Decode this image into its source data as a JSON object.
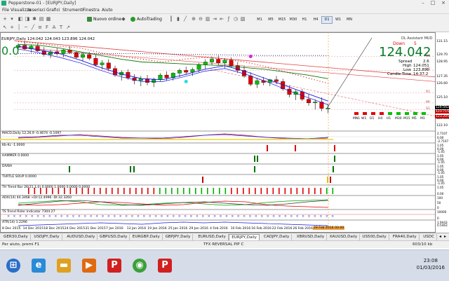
{
  "window": {
    "title": "Pepperstone-01 - [EURJPY,Daily]"
  },
  "menu": [
    "File",
    "Visualizza",
    "Inserisci",
    "Grafici",
    "Strumenti",
    "Finestra",
    "Aiuto"
  ],
  "toolbar": {
    "new_order": "Nuovo ordine",
    "autotrading": "AutoTrading",
    "timeframes": [
      "M1",
      "M5",
      "M15",
      "M30",
      "H1",
      "H4",
      "D1",
      "W1",
      "MN"
    ],
    "active_timeframe": "D1"
  },
  "chart": {
    "symbol_line": "EURJPY,Daily  124.042  124.043  123.896  124.042",
    "assistant_label": "DL Assistant MUD",
    "panel": {
      "direction": "Down",
      "direction_count": "5",
      "price": "124.042",
      "spread_label": "Spread",
      "spread_value": "2.6",
      "high_label": "High",
      "high_value": "124.051",
      "low_label": "Low",
      "low_value": "123.896",
      "candle_label": "Candle Time",
      "candle_value": "14:37:2",
      "mtf_labels": [
        "MN1",
        "W1",
        "D1",
        "H4",
        "H1",
        "M30",
        "M15",
        "M5",
        "M1"
      ],
      "mtf_colors": [
        "red",
        "red",
        "red",
        "red",
        "green",
        "green",
        "green",
        "green",
        "green"
      ]
    },
    "big_green_text": "0.0",
    "price_axis": [
      "131.15",
      "129.70",
      "128.95",
      "127.35",
      "126.60",
      "125.10",
      "124.042",
      "123.60",
      "122.855",
      "122.10"
    ],
    "price_tags": [
      {
        "text": "124.042",
        "color": "#000000"
      },
      {
        "text": "123.715",
        "color": "#c00000"
      },
      {
        "text": "123.205",
        "color": "#c00000"
      }
    ],
    "right_labels": [
      "R3",
      "R2",
      "R1",
      "PP",
      "S1"
    ],
    "indicators": [
      {
        "label": "MACD,Daily 12,26,9  -0.4674  -0.1097",
        "axis": [
          "2.7107",
          "0.00",
          "-2.7107"
        ]
      },
      {
        "label": "Kb-Kc -1.0000",
        "axis": [
          "1.05",
          "0.00",
          "-1.05"
        ]
      },
      {
        "label": "HAMMER 0.0000",
        "axis": [
          "1.05",
          "0.00",
          "-1.05"
        ]
      },
      {
        "label": "DIVBA",
        "axis": [
          "1.05",
          "0.00",
          "-1.05"
        ]
      },
      {
        "label": "TURTLE SOUP 0.0000",
        "axis": [
          "1.05",
          "0.00",
          "-1.05"
        ]
      },
      {
        "label": "TH Trend Bar 26(21,1,0) 0.0000 1.0000 0.0000 0.0000",
        "axis": [
          "1.05",
          "0.00"
        ]
      },
      {
        "label": "ADX(14) 44.3468 +DI:12.4996 -DI:32.3260",
        "axis": [
          "100",
          "50",
          "0"
        ]
      },
      {
        "label": "TS Trend Rider Indicator 7304.27",
        "axis": [
          "10000",
          "0"
        ]
      },
      {
        "label": "ATR(14) 1.2296",
        "axis": [
          "1.9443",
          "0.5463"
        ]
      }
    ],
    "dates": [
      "8 Dec 2015",
      "14 Dec 2015",
      "18 Dec 2015",
      "24 Dec 2015",
      "31 Dec 2015",
      "7 Jan 2016",
      "13 Jan 2016",
      "19 Jan 2016",
      "25 Jan 2016",
      "29 Jan 2016",
      "4 Feb 2016",
      "10 Feb 2016",
      "16 Feb 2016",
      "22 Feb 2016",
      "26 Feb 2016"
    ],
    "date_highlight": "29 Feb 2016 00:00"
  },
  "tabs": [
    "GER30,Daily",
    "USDJPY,Daily",
    "AUDUSD,Daily",
    "GBPUSD,Daily",
    "EURGBP,Daily",
    "GBPJPY,Daily",
    "EURUSD,Daily",
    "EURJPY,Daily",
    "CADJPY,Daily",
    "XBRUSD,Daily",
    "XAUUSD,Daily",
    "US500,Daily",
    "FRA40,Daily",
    "USDC"
  ],
  "active_tab": "EURJPY,Daily",
  "status": {
    "help": "Per aiuto, premi F1",
    "profile": "TFX REVERSAL PIP C",
    "connection": "603/10 kb"
  },
  "taskbar": {
    "time": "23:08",
    "date": "01/03/2016"
  },
  "colors": {
    "bull": "#00bf00",
    "bear": "#e00000",
    "ma_red": "#d81c1c",
    "ma_blue": "#1a1ae0",
    "ma_green": "#0a7a0a",
    "price_green": "#0a8a2a"
  }
}
